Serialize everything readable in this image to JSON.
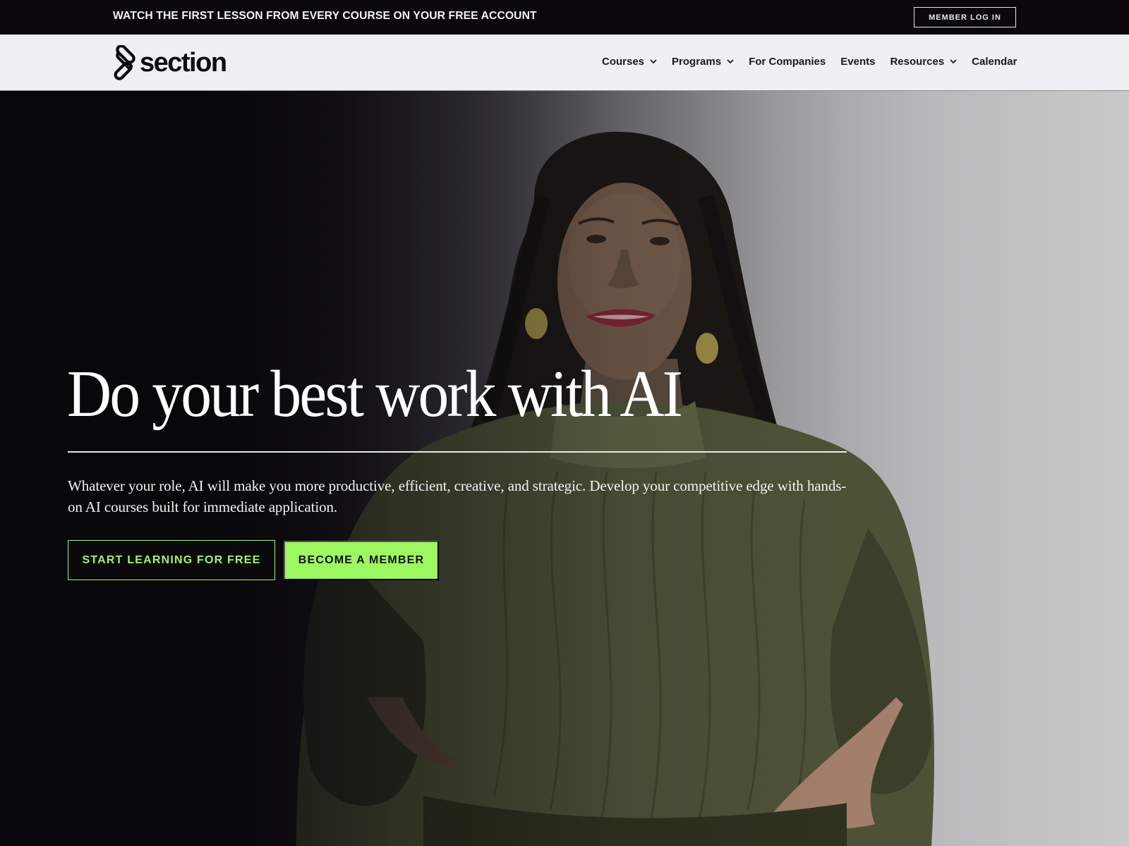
{
  "announcement": {
    "text": "WATCH THE FIRST LESSON FROM EVERY COURSE ON YOUR FREE ACCOUNT",
    "login_label": "MEMBER LOG IN"
  },
  "brand": {
    "name": "section",
    "logo_icon": "paperclip-s-icon"
  },
  "nav": {
    "items": [
      {
        "label": "Courses",
        "has_dropdown": true
      },
      {
        "label": "Programs",
        "has_dropdown": true
      },
      {
        "label": "For Companies",
        "has_dropdown": false
      },
      {
        "label": "Events",
        "has_dropdown": false
      },
      {
        "label": "Resources",
        "has_dropdown": true
      },
      {
        "label": "Calendar",
        "has_dropdown": false
      }
    ]
  },
  "hero": {
    "headline": "Do your best work with AI",
    "subtext": "Whatever your role, AI will make you more productive, efficient, creative, and strategic. Develop your competitive edge with hands-on AI courses built for immediate application.",
    "primary_cta": "START LEARNING FOR FREE",
    "secondary_cta": "BECOME A MEMBER",
    "background": "video-still-presenter-woman-green-blouse"
  },
  "colors": {
    "accent_green": "#9df760",
    "announcement_bg": "#0a080d",
    "nav_bg": "#efeff4"
  }
}
